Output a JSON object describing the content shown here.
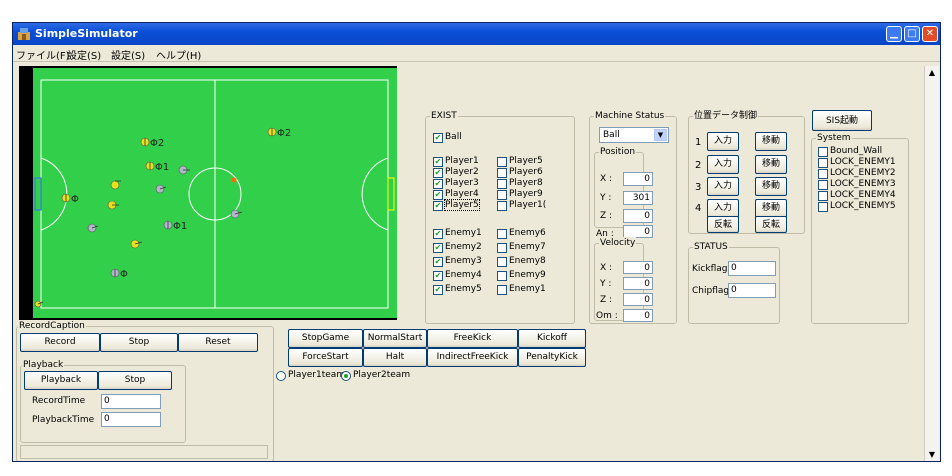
{
  "window": {
    "title": "SimpleSimulator"
  },
  "menu": [
    "ファイル(F)",
    "設定(S)",
    "設定(S)",
    "ヘルプ(H)"
  ],
  "field": {
    "robots": [
      {
        "label": "Φ2",
        "team": "yellow"
      },
      {
        "label": "Φ2",
        "team": "yellow"
      },
      {
        "label": "Φ1",
        "team": "yellow"
      },
      {
        "label": "Φ1",
        "team": "blue"
      },
      {
        "label": "Φ",
        "team": "yellow"
      },
      {
        "label": "Φ",
        "team": "blue"
      }
    ]
  },
  "exist": {
    "caption": "EXIST",
    "ball": "Ball",
    "players_left": [
      "Player1",
      "Player2",
      "Player3",
      "Player4",
      "Player5"
    ],
    "players_right": [
      "Player5",
      "Player6",
      "Player8",
      "Player9",
      "Player1("
    ],
    "enemies_left": [
      "Enemy1",
      "Enemy2",
      "Enemy3",
      "Enemy4",
      "Enemy5"
    ],
    "enemies_right": [
      "Enemy6",
      "Enemy7",
      "Enemy8",
      "Enemy9",
      "Enemy1"
    ]
  },
  "machine_status": {
    "caption": "Machine Status",
    "selected": "Ball",
    "position_caption": "Position",
    "x_label": "X :",
    "x_value": "0",
    "y_label": "Y :",
    "y_value": "301",
    "z_label": "Z :",
    "z_value": "0",
    "an_label": "An :",
    "an_value": "0",
    "velocity_caption": "Velocity",
    "vx_label": "X :",
    "vx_value": "0",
    "vy_label": "Y :",
    "vy_value": "0",
    "vz_label": "Z :",
    "vz_value": "0",
    "om_label": "Om :",
    "om_value": "0"
  },
  "position_control": {
    "caption": "位置データ制御",
    "rows": [
      {
        "num": "1",
        "input": "入力",
        "move": "移動"
      },
      {
        "num": "2",
        "input": "入力",
        "move": "移動"
      },
      {
        "num": "3",
        "input": "入力",
        "move": "移動"
      },
      {
        "num": "4",
        "input": "入力",
        "move": "移動"
      }
    ],
    "flip1": "反転",
    "flip2": "反転"
  },
  "status": {
    "caption": "STATUS",
    "kickflag_label": "Kickflag",
    "kickflag_value": "0",
    "chipflag_label": "Chipflag",
    "chipflag_value": "0"
  },
  "sis_button": "SIS起動",
  "system": {
    "caption": "System",
    "items": [
      "Bound_Wall",
      "LOCK_ENEMY1",
      "LOCK_ENEMY2",
      "LOCK_ENEMY3",
      "LOCK_ENEMY4",
      "LOCK_ENEMY5"
    ]
  },
  "record": {
    "caption": "RecordCaption",
    "record": "Record",
    "stop": "Stop",
    "reset": "Reset",
    "playback_caption": "Playback",
    "playback": "Playback",
    "playback_stop": "Stop",
    "record_time_label": "RecordTime",
    "record_time_value": "0",
    "playback_time_label": "PlaybackTime",
    "playback_time_value": "0"
  },
  "game_controls": {
    "row1": [
      "StopGame",
      "NormalStart",
      "FreeKick",
      "Kickoff"
    ],
    "row2": [
      "ForceStart",
      "Halt",
      "IndirectFreeKick",
      "PenaltyKick"
    ],
    "team1": "Player1team",
    "team2": "Player2team",
    "selected_team": "Player2team"
  }
}
